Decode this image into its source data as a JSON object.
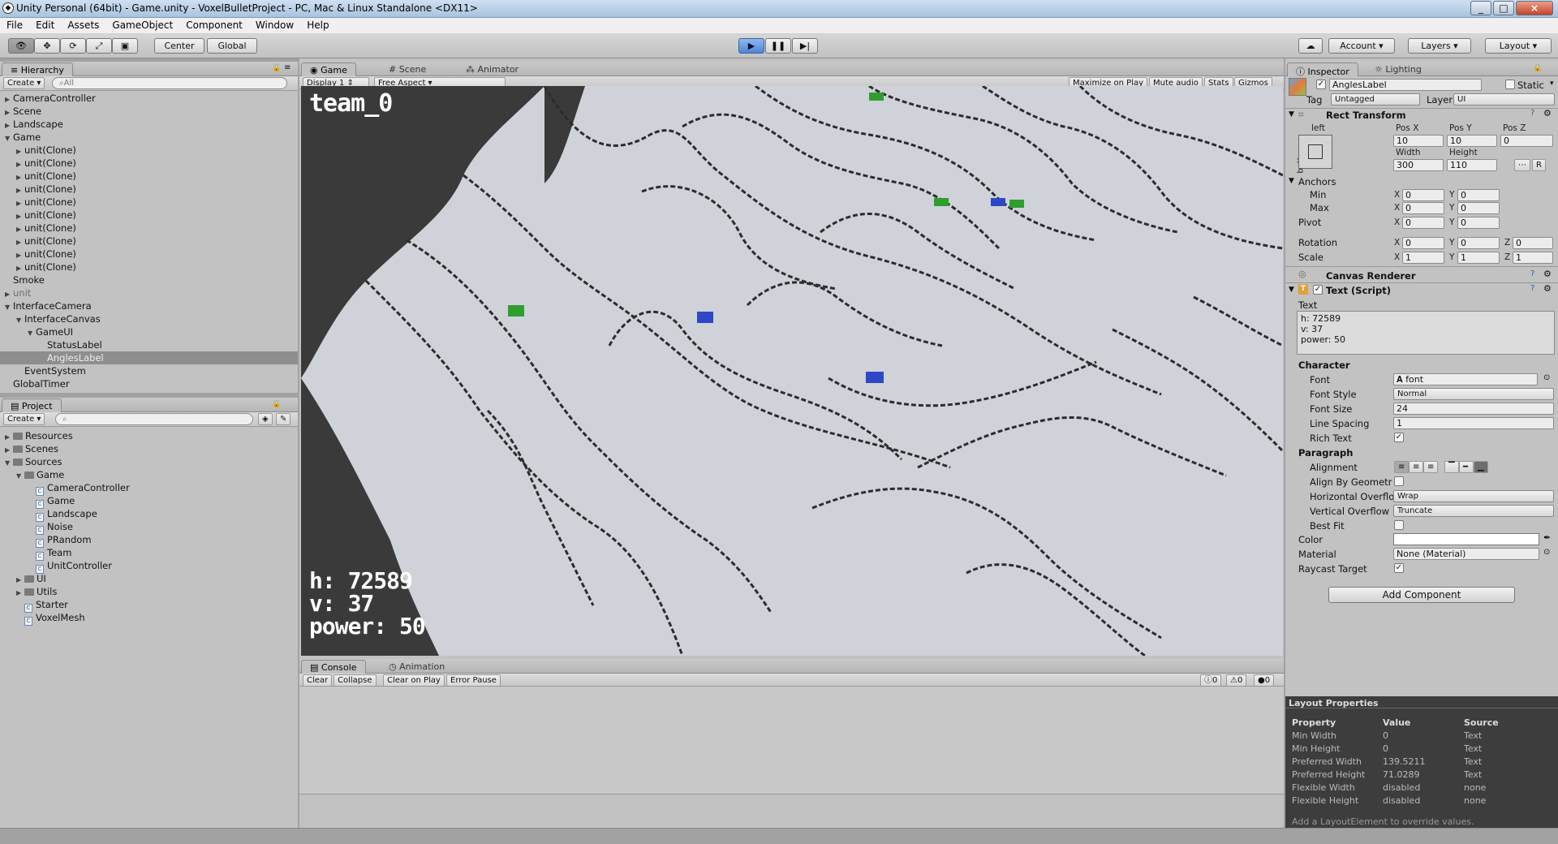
{
  "window": {
    "title": "Unity Personal (64bit) - Game.unity - VoxelBulletProject - PC, Mac & Linux Standalone <DX11>",
    "controls": [
      "_",
      "□",
      "×"
    ]
  },
  "menu": [
    "File",
    "Edit",
    "Assets",
    "GameObject",
    "Component",
    "Window",
    "Help"
  ],
  "toolbar": {
    "center": "Center",
    "global": "Global",
    "account": "Account",
    "layers": "Layers",
    "layout": "Layout"
  },
  "hierarchy": {
    "tab": "Hierarchy",
    "create": "Create",
    "search": "All",
    "items": [
      {
        "label": "CameraController",
        "level": 0,
        "arrow": "▶"
      },
      {
        "label": "Scene",
        "level": 0,
        "arrow": "▶"
      },
      {
        "label": "Landscape",
        "level": 0,
        "arrow": "▶"
      },
      {
        "label": "Game",
        "level": 0,
        "arrow": "▼"
      },
      {
        "label": "unit(Clone)",
        "level": 1,
        "arrow": "▶"
      },
      {
        "label": "unit(Clone)",
        "level": 1,
        "arrow": "▶"
      },
      {
        "label": "unit(Clone)",
        "level": 1,
        "arrow": "▶"
      },
      {
        "label": "unit(Clone)",
        "level": 1,
        "arrow": "▶"
      },
      {
        "label": "unit(Clone)",
        "level": 1,
        "arrow": "▶"
      },
      {
        "label": "unit(Clone)",
        "level": 1,
        "arrow": "▶"
      },
      {
        "label": "unit(Clone)",
        "level": 1,
        "arrow": "▶"
      },
      {
        "label": "unit(Clone)",
        "level": 1,
        "arrow": "▶"
      },
      {
        "label": "unit(Clone)",
        "level": 1,
        "arrow": "▶"
      },
      {
        "label": "unit(Clone)",
        "level": 1,
        "arrow": "▶"
      },
      {
        "label": "Smoke",
        "level": 0,
        "arrow": ""
      },
      {
        "label": "unit",
        "level": 0,
        "arrow": "▶",
        "gray": true
      },
      {
        "label": "InterfaceCamera",
        "level": 0,
        "arrow": "▼"
      },
      {
        "label": "InterfaceCanvas",
        "level": 1,
        "arrow": "▼"
      },
      {
        "label": "GameUI",
        "level": 2,
        "arrow": "▼"
      },
      {
        "label": "StatusLabel",
        "level": 3,
        "arrow": ""
      },
      {
        "label": "AnglesLabel",
        "level": 3,
        "arrow": "",
        "selected": true
      },
      {
        "label": "EventSystem",
        "level": 1,
        "arrow": ""
      },
      {
        "label": "GlobalTimer",
        "level": 0,
        "arrow": ""
      }
    ]
  },
  "project": {
    "tab": "Project",
    "create": "Create",
    "items": [
      {
        "label": "Resources",
        "level": 0,
        "arrow": "▶",
        "type": "folder"
      },
      {
        "label": "Scenes",
        "level": 0,
        "arrow": "▶",
        "type": "folder"
      },
      {
        "label": "Sources",
        "level": 0,
        "arrow": "▼",
        "type": "folder"
      },
      {
        "label": "Game",
        "level": 1,
        "arrow": "▼",
        "type": "folder"
      },
      {
        "label": "CameraController",
        "level": 2,
        "arrow": "",
        "type": "script"
      },
      {
        "label": "Game",
        "level": 2,
        "arrow": "",
        "type": "script"
      },
      {
        "label": "Landscape",
        "level": 2,
        "arrow": "",
        "type": "script"
      },
      {
        "label": "Noise",
        "level": 2,
        "arrow": "",
        "type": "script"
      },
      {
        "label": "PRandom",
        "level": 2,
        "arrow": "",
        "type": "script"
      },
      {
        "label": "Team",
        "level": 2,
        "arrow": "",
        "type": "script"
      },
      {
        "label": "UnitController",
        "level": 2,
        "arrow": "",
        "type": "script"
      },
      {
        "label": "UI",
        "level": 1,
        "arrow": "▶",
        "type": "folder"
      },
      {
        "label": "Utils",
        "level": 1,
        "arrow": "▶",
        "type": "folder"
      },
      {
        "label": "Starter",
        "level": 1,
        "arrow": "",
        "type": "script"
      },
      {
        "label": "VoxelMesh",
        "level": 1,
        "arrow": "",
        "type": "script"
      }
    ]
  },
  "gameview": {
    "tabs": [
      "Game",
      "Scene",
      "Animator"
    ],
    "display": "Display 1",
    "aspect": "Free Aspect",
    "buttons": [
      "Maximize on Play",
      "Mute audio",
      "Stats",
      "Gizmos"
    ],
    "status_label": "team_0",
    "stats_lines": [
      "h: 72589",
      "v: 37",
      "power: 50"
    ]
  },
  "console": {
    "tabs": [
      "Console",
      "Animation"
    ],
    "buttons": [
      "Clear",
      "Collapse",
      "Clear on Play",
      "Error Pause"
    ],
    "counts": [
      "0",
      "0",
      "0"
    ]
  },
  "inspector": {
    "tabs": [
      "Inspector",
      "Lighting"
    ],
    "object_name": "AnglesLabel",
    "static": "Static",
    "tag_label": "Tag",
    "tag": "Untagged",
    "layer_label": "Layer",
    "layer": "UI",
    "rect": {
      "title": "Rect Transform",
      "anchor_h": "left",
      "anchor_v": "bottom",
      "posx_l": "Pos X",
      "posy_l": "Pos Y",
      "posz_l": "Pos Z",
      "posx": "10",
      "posy": "10",
      "posz": "0",
      "width_l": "Width",
      "height_l": "Height",
      "width": "300",
      "height": "110",
      "r": "R",
      "anchors": "Anchors",
      "min": "Min",
      "max": "Max",
      "pivot": "Pivot",
      "rotation": "Rotation",
      "scale": "Scale",
      "min_x": "0",
      "min_y": "0",
      "max_x": "0",
      "max_y": "0",
      "pivot_x": "0",
      "pivot_y": "0",
      "rot_x": "0",
      "rot_y": "0",
      "rot_z": "0",
      "sc_x": "1",
      "sc_y": "1",
      "sc_z": "1"
    },
    "canvas_renderer": "Canvas Renderer",
    "text_script": {
      "title": "Text (Script)",
      "text_label": "Text",
      "text_lines": [
        "h: 72589",
        "v: 37",
        "power: 50"
      ],
      "character": "Character",
      "font_l": "Font",
      "font": "font",
      "fontstyle_l": "Font Style",
      "fontstyle": "Normal",
      "fontsize_l": "Font Size",
      "fontsize": "24",
      "linespacing_l": "Line Spacing",
      "linespacing": "1",
      "richtext_l": "Rich Text",
      "paragraph": "Paragraph",
      "alignment_l": "Alignment",
      "aligngeom_l": "Align By Geometr",
      "hoverflow_l": "Horizontal Overflo",
      "hoverflow": "Wrap",
      "voverflow_l": "Vertical Overflow",
      "voverflow": "Truncate",
      "bestfit_l": "Best Fit",
      "color_l": "Color",
      "color": "#ffffff",
      "material_l": "Material",
      "material": "None (Material)",
      "raycast_l": "Raycast Target"
    },
    "add_component": "Add Component"
  },
  "layout_properties": {
    "title": "Layout Properties",
    "headers": [
      "Property",
      "Value",
      "Source"
    ],
    "rows": [
      [
        "Min Width",
        "0",
        "Text"
      ],
      [
        "Min Height",
        "0",
        "Text"
      ],
      [
        "Preferred Width",
        "139.5211",
        "Text"
      ],
      [
        "Preferred Height",
        "71.0289",
        "Text"
      ],
      [
        "Flexible Width",
        "disabled",
        "none"
      ],
      [
        "Flexible Height",
        "disabled",
        "none"
      ]
    ],
    "footer": "Add a LayoutElement to override values."
  }
}
